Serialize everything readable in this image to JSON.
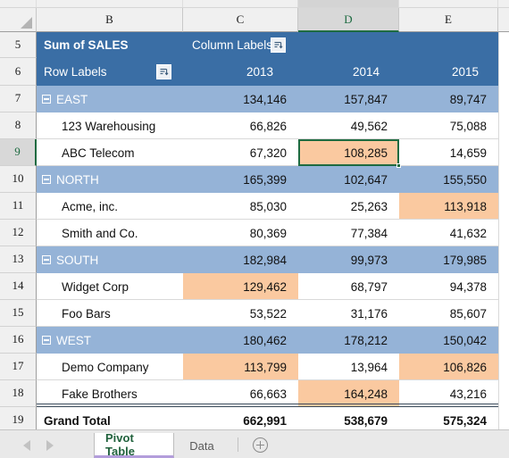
{
  "grid": {
    "column_headers": [
      "B",
      "C",
      "D",
      "E"
    ],
    "selected_column": "D",
    "selected_row": "9",
    "selected_cell": "D9",
    "row_numbers": [
      "5",
      "6",
      "7",
      "8",
      "9",
      "10",
      "11",
      "12",
      "13",
      "14",
      "15",
      "16",
      "17",
      "18",
      "19"
    ]
  },
  "pivot": {
    "value_field_label": "Sum of SALES",
    "column_labels_label": "Column Labels",
    "row_labels_label": "Row Labels",
    "column_headers": [
      "2013",
      "2014",
      "2015"
    ],
    "rows": [
      {
        "row": "7",
        "label": "EAST",
        "type": "group",
        "values": [
          "134,146",
          "157,847",
          "89,747"
        ],
        "highlight": [
          false,
          false,
          false
        ]
      },
      {
        "row": "8",
        "label": "123 Warehousing",
        "type": "item",
        "values": [
          "66,826",
          "49,562",
          "75,088"
        ],
        "highlight": [
          false,
          false,
          false
        ]
      },
      {
        "row": "9",
        "label": "ABC Telecom",
        "type": "item",
        "values": [
          "67,320",
          "108,285",
          "14,659"
        ],
        "highlight": [
          false,
          true,
          false
        ]
      },
      {
        "row": "10",
        "label": "NORTH",
        "type": "group",
        "values": [
          "165,399",
          "102,647",
          "155,550"
        ],
        "highlight": [
          false,
          false,
          false
        ]
      },
      {
        "row": "11",
        "label": "Acme, inc.",
        "type": "item",
        "values": [
          "85,030",
          "25,263",
          "113,918"
        ],
        "highlight": [
          false,
          false,
          true
        ]
      },
      {
        "row": "12",
        "label": "Smith and Co.",
        "type": "item",
        "values": [
          "80,369",
          "77,384",
          "41,632"
        ],
        "highlight": [
          false,
          false,
          false
        ]
      },
      {
        "row": "13",
        "label": "SOUTH",
        "type": "group",
        "values": [
          "182,984",
          "99,973",
          "179,985"
        ],
        "highlight": [
          false,
          false,
          false
        ]
      },
      {
        "row": "14",
        "label": "Widget Corp",
        "type": "item",
        "values": [
          "129,462",
          "68,797",
          "94,378"
        ],
        "highlight": [
          true,
          false,
          false
        ]
      },
      {
        "row": "15",
        "label": "Foo Bars",
        "type": "item",
        "values": [
          "53,522",
          "31,176",
          "85,607"
        ],
        "highlight": [
          false,
          false,
          false
        ]
      },
      {
        "row": "16",
        "label": "WEST",
        "type": "group",
        "values": [
          "180,462",
          "178,212",
          "150,042"
        ],
        "highlight": [
          false,
          false,
          false
        ]
      },
      {
        "row": "17",
        "label": "Demo Company",
        "type": "item",
        "values": [
          "113,799",
          "13,964",
          "106,826"
        ],
        "highlight": [
          true,
          false,
          true
        ]
      },
      {
        "row": "18",
        "label": "Fake Brothers",
        "type": "item",
        "values": [
          "66,663",
          "164,248",
          "43,216"
        ],
        "highlight": [
          false,
          true,
          false
        ]
      },
      {
        "row": "19",
        "label": "Grand Total",
        "type": "total",
        "values": [
          "662,991",
          "538,679",
          "575,324"
        ],
        "highlight": [
          false,
          false,
          false
        ]
      }
    ]
  },
  "icons": {
    "row_labels_filter": "filter-sort-icon",
    "column_labels_filter": "filter-sort-icon",
    "collapse": "collapse-minus-icon",
    "select_all": "select-all-triangle-icon",
    "nav_prev": "nav-previous-icon",
    "nav_next": "nav-next-icon",
    "add_sheet": "add-sheet-plus-icon"
  },
  "sheet_tabs": {
    "tabs": [
      {
        "name": "Pivot Table",
        "active": true
      },
      {
        "name": "Data",
        "active": false
      }
    ]
  },
  "colors": {
    "header_band": "#3a6ea5",
    "group_row": "#95b3d7",
    "highlight": "#fac9a0",
    "selection": "#1e6b41",
    "active_tab_text": "#21623d",
    "active_tab_underline": "#b39ddb"
  }
}
